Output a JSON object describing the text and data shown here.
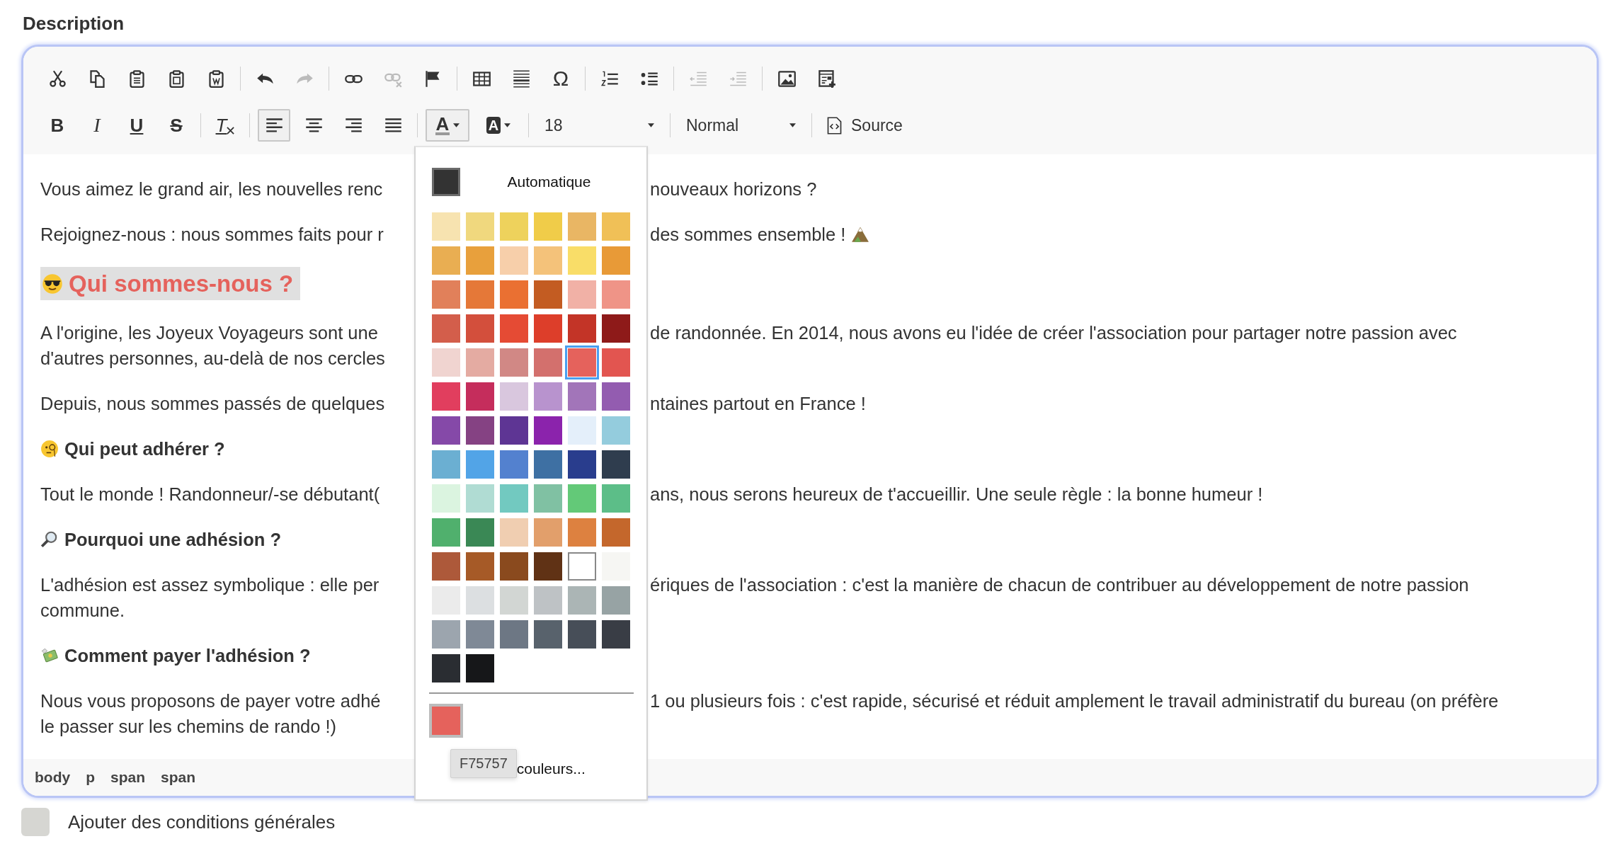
{
  "field_label": "Description",
  "toolbar_rows": [
    {
      "groups": [
        {
          "items": [
            {
              "kind": "cut",
              "disabled": false,
              "selected": false
            },
            {
              "kind": "copy",
              "disabled": false,
              "selected": false
            },
            {
              "kind": "paste",
              "disabled": false,
              "selected": false
            },
            {
              "kind": "paste-text",
              "disabled": false,
              "selected": false
            },
            {
              "kind": "paste-word",
              "disabled": false,
              "selected": false
            }
          ]
        },
        {
          "items": [
            {
              "kind": "undo",
              "disabled": false,
              "selected": false
            },
            {
              "kind": "redo",
              "disabled": true,
              "selected": false
            }
          ]
        },
        {
          "items": [
            {
              "kind": "link",
              "disabled": false,
              "selected": false
            },
            {
              "kind": "unlink",
              "disabled": true,
              "selected": false
            },
            {
              "kind": "anchor",
              "disabled": false,
              "selected": false
            }
          ]
        },
        {
          "items": [
            {
              "kind": "table",
              "disabled": false,
              "selected": false
            },
            {
              "kind": "horizontal-rule",
              "disabled": false,
              "selected": false
            },
            {
              "kind": "special-char",
              "label": "Ω",
              "disabled": false,
              "selected": false
            }
          ]
        },
        {
          "items": [
            {
              "kind": "numbered-list",
              "disabled": false,
              "selected": false
            },
            {
              "kind": "bulleted-list",
              "disabled": false,
              "selected": false
            }
          ]
        },
        {
          "items": [
            {
              "kind": "outdent",
              "disabled": true,
              "selected": false
            },
            {
              "kind": "indent",
              "disabled": true,
              "selected": false
            }
          ]
        },
        {
          "items": [
            {
              "kind": "image",
              "disabled": false,
              "selected": false
            },
            {
              "kind": "template",
              "disabled": false,
              "selected": false
            }
          ]
        }
      ]
    },
    {
      "groups": [
        {
          "items": [
            {
              "kind": "bold",
              "label": "B",
              "disabled": false,
              "selected": false
            },
            {
              "kind": "italic",
              "label": "I",
              "disabled": false,
              "selected": false
            },
            {
              "kind": "underline",
              "label": "U",
              "disabled": false,
              "selected": false
            },
            {
              "kind": "strike",
              "label": "S",
              "disabled": false,
              "selected": false
            }
          ]
        },
        {
          "items": [
            {
              "kind": "clear-format",
              "label": "T",
              "disabled": false,
              "selected": false
            }
          ]
        },
        {
          "items": [
            {
              "kind": "align-left",
              "disabled": false,
              "selected": true
            },
            {
              "kind": "align-center",
              "disabled": false,
              "selected": false
            },
            {
              "kind": "align-right",
              "disabled": false,
              "selected": false
            },
            {
              "kind": "justify",
              "disabled": false,
              "selected": false
            }
          ]
        },
        {
          "items": [
            {
              "kind": "text-color",
              "label": "A",
              "disabled": false,
              "selected": true
            },
            {
              "kind": "bg-color",
              "label": "A",
              "disabled": false,
              "selected": false
            }
          ]
        },
        {
          "items": [
            {
              "kind": "combo",
              "value": "18"
            }
          ]
        },
        {
          "items": [
            {
              "kind": "combo",
              "value": "Normal"
            }
          ]
        },
        {
          "items": [
            {
              "kind": "source",
              "label": "Source",
              "disabled": false
            }
          ]
        }
      ]
    }
  ],
  "content": [
    {
      "kind": "paragraph",
      "lines": [
        {
          "left": "Vous aimez le grand air, les nouvelles renc",
          "right": "nouveaux horizons ?"
        }
      ]
    },
    {
      "kind": "paragraph",
      "lines": [
        {
          "left": "Rejoignez-nous : nous sommes faits pour r",
          "right": "des sommes ensemble !"
        }
      ]
    },
    {
      "kind": "title",
      "text": "Qui sommes-nous ?"
    },
    {
      "kind": "paragraph",
      "lines": [
        {
          "left": "A l'origine, les Joyeux Voyageurs sont une",
          "right": "de randonnée. En 2014, nous avons eu l'idée de créer l'association pour partager notre passion avec"
        },
        {
          "left": "d'autres personnes, au-delà de nos cercles"
        }
      ]
    },
    {
      "kind": "paragraph",
      "lines": [
        {
          "left": "Depuis, nous sommes passés de quelques",
          "right": "ntaines partout en France !"
        }
      ]
    },
    {
      "kind": "heading",
      "text": "Qui peut adhérer ?"
    },
    {
      "kind": "paragraph",
      "lines": [
        {
          "left": "Tout le monde ! Randonneur/-se débutant(",
          "right": "ans, nous serons heureux de t'accueillir. Une seule règle : la bonne humeur !"
        }
      ]
    },
    {
      "kind": "heading",
      "text": "Pourquoi une adhésion ?"
    },
    {
      "kind": "paragraph",
      "lines": [
        {
          "left": "L'adhésion est assez symbolique : elle per",
          "right": "ériques de l'association : c'est la manière de chacun de contribuer au développement de notre passion"
        },
        {
          "left": "commune."
        }
      ]
    },
    {
      "kind": "heading",
      "text": "Comment payer l'adhésion ?"
    },
    {
      "kind": "paragraph",
      "lines": [
        {
          "left": "Nous vous proposons de payer votre adhé",
          "right": "1 ou plusieurs fois : c'est rapide, sécurisé et réduit amplement le travail administratif du bureau (on préfère"
        },
        {
          "left": "le passer sur les chemins de rando !)"
        }
      ]
    }
  ],
  "element_path": [
    "body",
    "p",
    "span",
    "span"
  ],
  "color_picker": {
    "automatic_label": "Automatique",
    "swatches": [
      {
        "color": "#f7e3b0",
        "selected": false
      },
      {
        "color": "#f0d87e",
        "selected": false
      },
      {
        "color": "#eed25c",
        "selected": false
      },
      {
        "color": "#f0cc49",
        "selected": false
      },
      {
        "color": "#e9b664",
        "selected": false
      },
      {
        "color": "#f0c057",
        "selected": false
      },
      {
        "color": "#e9ae52",
        "selected": false
      },
      {
        "color": "#e8a03c",
        "selected": false
      },
      {
        "color": "#f7cfaa",
        "selected": false
      },
      {
        "color": "#f4c27a",
        "selected": false
      },
      {
        "color": "#f9dd68",
        "selected": false
      },
      {
        "color": "#e89a37",
        "selected": false
      },
      {
        "color": "#e1805a",
        "selected": false
      },
      {
        "color": "#e57838",
        "selected": false
      },
      {
        "color": "#ea7032",
        "selected": false
      },
      {
        "color": "#c35c22",
        "selected": false
      },
      {
        "color": "#f1b1a6",
        "selected": false
      },
      {
        "color": "#ef9487",
        "selected": false
      },
      {
        "color": "#d35e4b",
        "selected": false
      },
      {
        "color": "#d34f3c",
        "selected": false
      },
      {
        "color": "#e54b34",
        "selected": false
      },
      {
        "color": "#dd3e2a",
        "selected": false
      },
      {
        "color": "#c33427",
        "selected": false
      },
      {
        "color": "#8e1a19",
        "selected": false
      },
      {
        "color": "#f0d4d0",
        "selected": false
      },
      {
        "color": "#e4aba2",
        "selected": false
      },
      {
        "color": "#d18885",
        "selected": false
      },
      {
        "color": "#d3706d",
        "selected": false
      },
      {
        "color": "#e5625c",
        "selected": true
      },
      {
        "color": "#e25550",
        "selected": false
      },
      {
        "color": "#e13e5e",
        "selected": false
      },
      {
        "color": "#c52d5c",
        "selected": false
      },
      {
        "color": "#d9c7de",
        "selected": false
      },
      {
        "color": "#b893ce",
        "selected": false
      },
      {
        "color": "#a275b9",
        "selected": false
      },
      {
        "color": "#935cb0",
        "selected": false
      },
      {
        "color": "#8549a8",
        "selected": false
      },
      {
        "color": "#854283",
        "selected": false
      },
      {
        "color": "#5e3594",
        "selected": false
      },
      {
        "color": "#8b23ac",
        "selected": false
      },
      {
        "color": "#e4effa",
        "selected": false
      },
      {
        "color": "#94ccdd",
        "selected": false
      },
      {
        "color": "#6bafd2",
        "selected": false
      },
      {
        "color": "#52a4e7",
        "selected": false
      },
      {
        "color": "#5381cf",
        "selected": false
      },
      {
        "color": "#3e70a3",
        "selected": false
      },
      {
        "color": "#293d8d",
        "selected": false
      },
      {
        "color": "#2f3d4e",
        "selected": false
      },
      {
        "color": "#dbf4e0",
        "selected": false
      },
      {
        "color": "#b0dcd3",
        "selected": false
      },
      {
        "color": "#72c9c0",
        "selected": false
      },
      {
        "color": "#80c1a3",
        "selected": false
      },
      {
        "color": "#63c978",
        "selected": false
      },
      {
        "color": "#5cbe88",
        "selected": false
      },
      {
        "color": "#50b06d",
        "selected": false
      },
      {
        "color": "#3a8855",
        "selected": false
      },
      {
        "color": "#f0ceb1",
        "selected": false
      },
      {
        "color": "#e29f6b",
        "selected": false
      },
      {
        "color": "#dd8140",
        "selected": false
      },
      {
        "color": "#c4672c",
        "selected": false
      },
      {
        "color": "#ad593a",
        "selected": false
      },
      {
        "color": "#a65a27",
        "selected": false
      },
      {
        "color": "#8a4a1e",
        "selected": false
      },
      {
        "color": "#603215",
        "selected": false
      },
      {
        "color": "#ffffff",
        "selected": false
      },
      {
        "color": "#f6f6f3",
        "selected": false
      },
      {
        "color": "#ebebeb",
        "selected": false
      },
      {
        "color": "#dcdfe1",
        "selected": false
      },
      {
        "color": "#d2d6d3",
        "selected": false
      },
      {
        "color": "#bec2c5",
        "selected": false
      },
      {
        "color": "#abb5b5",
        "selected": false
      },
      {
        "color": "#97a3a4",
        "selected": false
      },
      {
        "color": "#9ca5ae",
        "selected": false
      },
      {
        "color": "#7f8996",
        "selected": false
      },
      {
        "color": "#6d7784",
        "selected": false
      },
      {
        "color": "#58626c",
        "selected": false
      },
      {
        "color": "#474e58",
        "selected": false
      },
      {
        "color": "#393d45",
        "selected": false
      },
      {
        "color": "#2a2d32",
        "selected": false
      },
      {
        "color": "#161719",
        "selected": false
      }
    ],
    "recent_colors": [
      {
        "color": "#e5625c"
      }
    ],
    "tooltip": "F75757",
    "more_colors_label": "couleurs..."
  },
  "terms_checkbox": {
    "label": "Ajouter des conditions générales",
    "checked": false
  }
}
